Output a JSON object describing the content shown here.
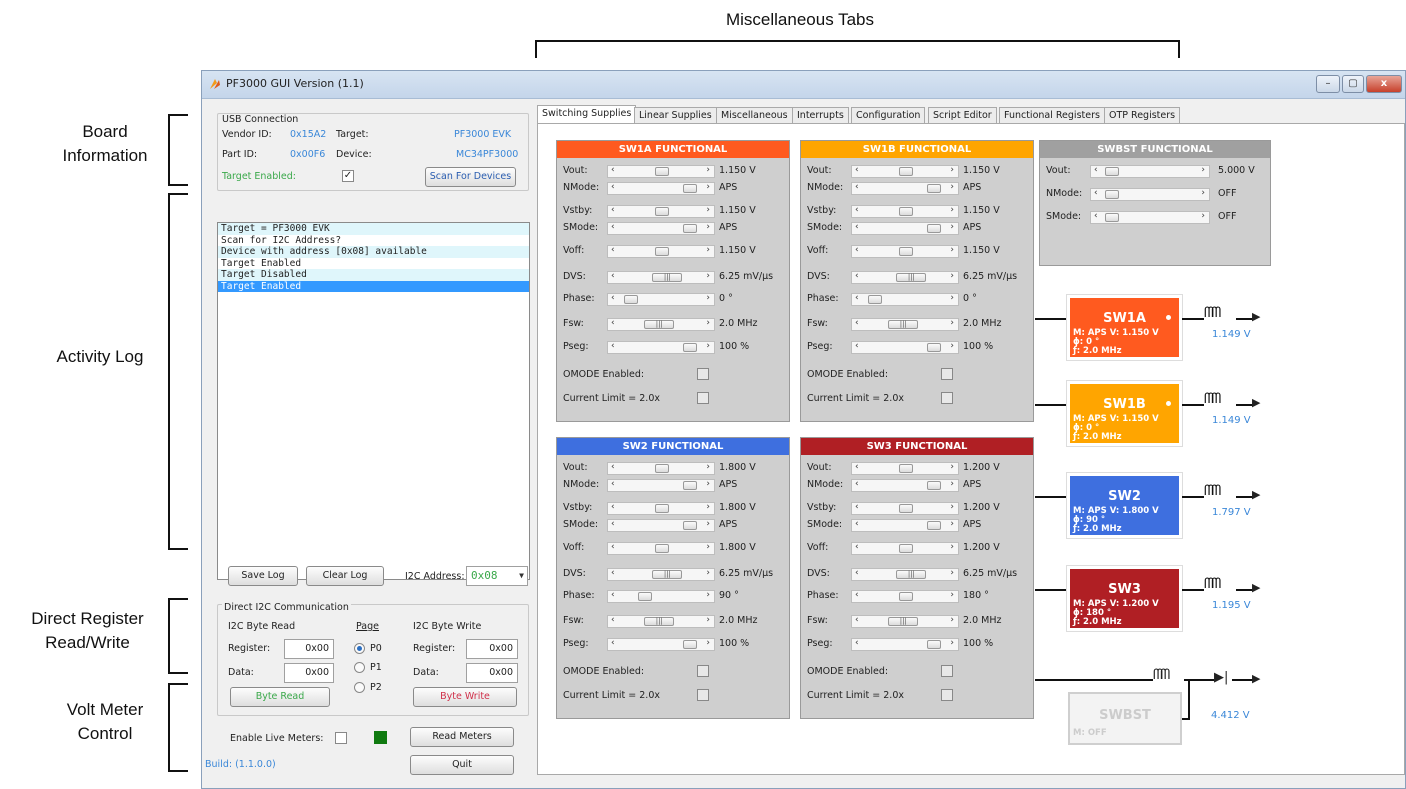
{
  "annotations": {
    "misc_tabs": "Miscellaneous Tabs",
    "board_info": "Board\nInformation",
    "activity_log": "Activity Log",
    "direct_reg": "Direct Register\nRead/Write",
    "volt_meter": "Volt Meter\nControl"
  },
  "window": {
    "title": "PF3000 GUI Version (1.1)",
    "min": "–",
    "max": "▢",
    "close": "x"
  },
  "usb": {
    "heading": "USB Connection",
    "vendor_label": "Vendor ID:",
    "vendor_value": "0x15A2",
    "target_label": "Target:",
    "target_value": "PF3000 EVK",
    "part_label": "Part ID:",
    "part_value": "0x00F6",
    "device_label": "Device:",
    "device_value": "MC34PF3000",
    "enabled_label": "Target Enabled:",
    "enabled_check": "✓",
    "scan_button": "Scan For Devices"
  },
  "log": {
    "lines": [
      "Target = PF3000 EVK",
      "Scan for I2C Address?",
      "Device with address [0x08] available",
      "Target Enabled",
      "Target Disabled",
      "Target Enabled"
    ],
    "save_button": "Save Log",
    "clear_button": "Clear Log",
    "i2c_label": "I2C Address:",
    "i2c_value": "0x08"
  },
  "direct": {
    "heading": "Direct I2C Communication",
    "read_heading": "I2C Byte Read",
    "page_heading": "Page",
    "write_heading": "I2C Byte Write",
    "register_label": "Register:",
    "data_label": "Data:",
    "read_register": "0x00",
    "read_data": "0x00",
    "write_register": "0x00",
    "write_data": "0x00",
    "pages": [
      "P0",
      "P1",
      "P2"
    ],
    "read_button": "Byte Read",
    "write_button": "Byte Write"
  },
  "meters": {
    "enable_label": "Enable Live Meters:",
    "read_button": "Read Meters",
    "quit_button": "Quit",
    "build": "Build: (1.1.0.0)"
  },
  "tabs": [
    "Switching Supplies",
    "Linear Supplies",
    "Miscellaneous",
    "Interrupts",
    "Configuration",
    "Script Editor",
    "Functional Registers",
    "OTP Registers"
  ],
  "colors": {
    "sw1a": "#ff5a1f",
    "sw1b": "#ffa500",
    "sw2": "#3e6fdf",
    "sw3": "#b01f24",
    "swbst": "#a0a0a0"
  },
  "sw1a": {
    "title": "SW1A FUNCTIONAL",
    "vout": "1.150 V",
    "nmode": "APS",
    "vstby": "1.150 V",
    "smode": "APS",
    "voff": "1.150 V",
    "dvs": "6.25 mV/µs",
    "phase": "0 °",
    "fsw": "2.0 MHz",
    "pseg": "100 %"
  },
  "sw1b": {
    "title": "SW1B FUNCTIONAL",
    "vout": "1.150 V",
    "nmode": "APS",
    "vstby": "1.150 V",
    "smode": "APS",
    "voff": "1.150 V",
    "dvs": "6.25 mV/µs",
    "phase": "0 °",
    "fsw": "2.0 MHz",
    "pseg": "100 %"
  },
  "sw2": {
    "title": "SW2 FUNCTIONAL",
    "vout": "1.800 V",
    "nmode": "APS",
    "vstby": "1.800 V",
    "smode": "APS",
    "voff": "1.800 V",
    "dvs": "6.25 mV/µs",
    "phase": "90 °",
    "fsw": "2.0 MHz",
    "pseg": "100 %"
  },
  "sw3": {
    "title": "SW3 FUNCTIONAL",
    "vout": "1.200 V",
    "nmode": "APS",
    "vstby": "1.200 V",
    "smode": "APS",
    "voff": "1.200 V",
    "dvs": "6.25 mV/µs",
    "phase": "180 °",
    "fsw": "2.0 MHz",
    "pseg": "100 %"
  },
  "swbst": {
    "title": "SWBST FUNCTIONAL",
    "vout": "5.000 V",
    "nmode": "OFF",
    "smode": "OFF"
  },
  "labels": {
    "vout": "Vout:",
    "nmode": "NMode:",
    "vstby": "Vstby:",
    "smode": "SMode:",
    "voff": "Voff:",
    "dvs": "DVS:",
    "phase": "Phase:",
    "fsw": "Fsw:",
    "pseg": "Pseg:",
    "omode": "OMODE Enabled:",
    "ilim": "Current Limit = 2.0x"
  },
  "blocks": {
    "sw1a": {
      "name": "SW1A",
      "line1": "M: APS   V: 1.150 V",
      "line2": "ɸ: 0 °",
      "line3": "ƒ: 2.0 MHz",
      "meas": "1.149 V"
    },
    "sw1b": {
      "name": "SW1B",
      "line1": "M: APS   V: 1.150 V",
      "line2": "ɸ: 0 °",
      "line3": "ƒ: 2.0 MHz",
      "meas": "1.149 V"
    },
    "sw2": {
      "name": "SW2",
      "line1": "M: APS   V: 1.800 V",
      "line2": "ɸ: 90 °",
      "line3": "ƒ: 2.0 MHz",
      "meas": "1.797 V"
    },
    "sw3": {
      "name": "SW3",
      "line1": "M: APS   V: 1.200 V",
      "line2": "ɸ: 180 °",
      "line3": "ƒ: 2.0 MHz",
      "meas": "1.195 V"
    },
    "swbst": {
      "name": "SWBST",
      "line1": "M: OFF",
      "meas": "4.412 V"
    }
  }
}
